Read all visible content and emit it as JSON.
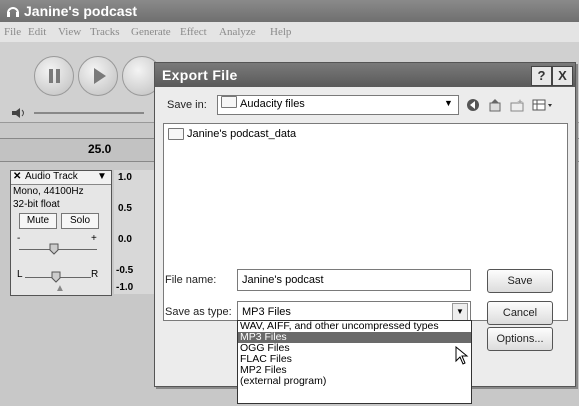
{
  "app": {
    "title": "Janine's podcast",
    "menu": [
      "File",
      "Edit",
      "View",
      "Tracks",
      "Generate",
      "Effect",
      "Analyze",
      "Help"
    ],
    "ruler_value": "25.0"
  },
  "track": {
    "name": "Audio Track",
    "format": "Mono, 44100Hz",
    "bitdepth": "32-bit float",
    "mute_label": "Mute",
    "solo_label": "Solo",
    "gain_minus": "-",
    "gain_plus": "+",
    "pan_left": "L",
    "pan_right": "R",
    "scale": [
      "1.0",
      "0.5",
      "0.0",
      "-0.5",
      "-1.0"
    ]
  },
  "dialog": {
    "title": "Export File",
    "save_in_label": "Save in:",
    "save_in_value": "Audacity files",
    "items": [
      "Janine's podcast_data"
    ],
    "filename_label": "File name:",
    "filename_value": "Janine's podcast",
    "saveas_label": "Save as type:",
    "saveas_value": "MP3 Files",
    "save_button": "Save",
    "cancel_button": "Cancel",
    "options_button": "Options...",
    "help_button": "?",
    "close_button": "X",
    "type_options": [
      "WAV, AIFF, and other uncompressed types",
      "MP3 Files",
      "OGG Files",
      "FLAC Files",
      "MP2 Files",
      "(external program)"
    ],
    "selected_option": "MP3 Files"
  }
}
